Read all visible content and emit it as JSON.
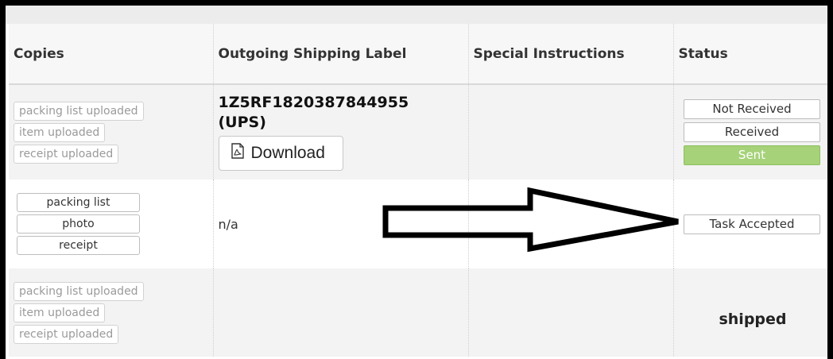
{
  "table": {
    "headers": {
      "copies": "Copies",
      "label": "Outgoing Shipping Label",
      "instructions": "Special Instructions",
      "status": "Status"
    },
    "rows": [
      {
        "copies": [
          "packing list uploaded",
          "item uploaded",
          "receipt uploaded"
        ],
        "tracking": "1Z5RF1820387844955 (UPS)",
        "download_label": "Download",
        "download_icon": "pdf-icon",
        "instructions": "",
        "status_buttons": [
          "Not Received",
          "Received",
          "Sent"
        ],
        "selected_status": "Sent"
      },
      {
        "copies": [
          "packing list",
          "photo",
          "receipt"
        ],
        "label_text": "n/a",
        "instructions": "",
        "status_buttons": [
          "Task Accepted"
        ]
      },
      {
        "copies": [
          "packing list uploaded",
          "item uploaded",
          "receipt uploaded"
        ],
        "instructions": "",
        "status_text": "shipped"
      }
    ]
  },
  "colors": {
    "sent_active": "#a6d279",
    "frame": "#000000"
  },
  "annotation": {
    "type": "hand-drawn arrow pointing right",
    "color": "#000000"
  }
}
